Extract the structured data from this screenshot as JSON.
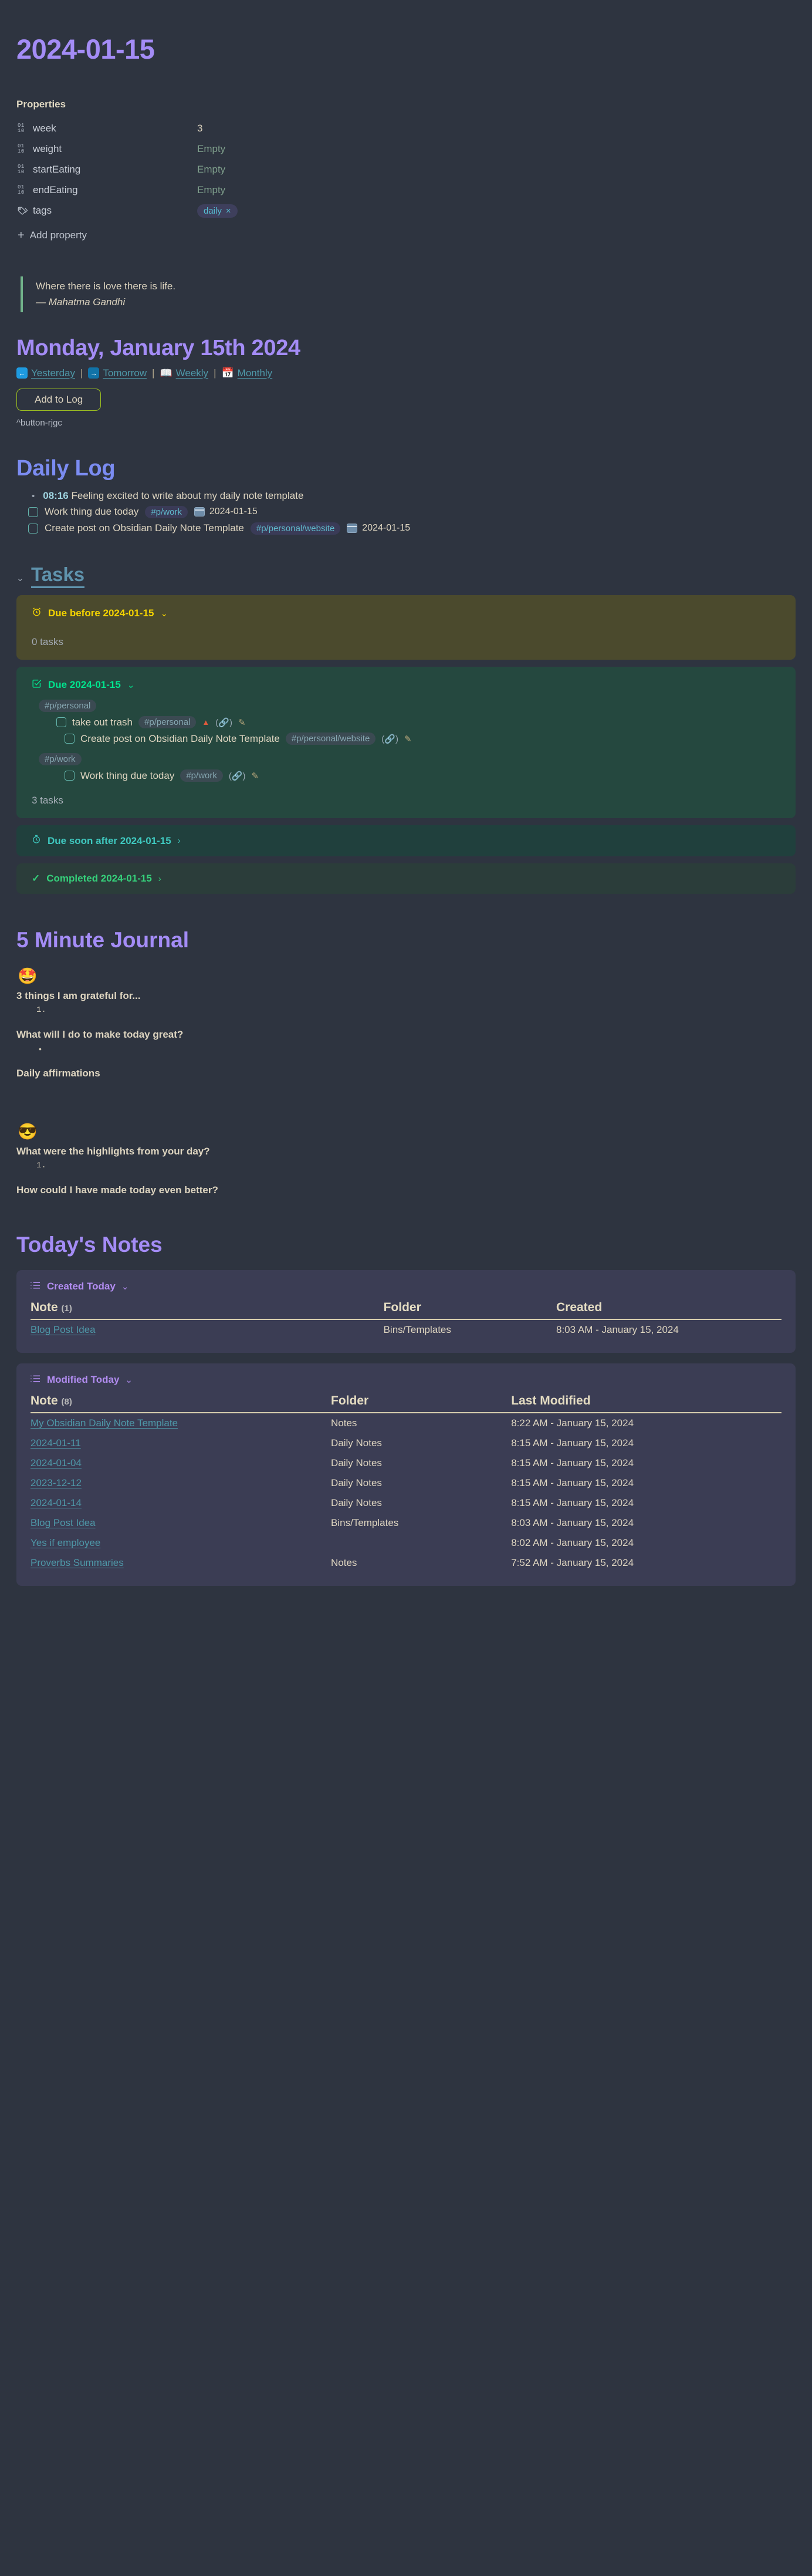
{
  "title": "2024-01-15",
  "properties": {
    "heading": "Properties",
    "rows": [
      {
        "icon": "number-icon",
        "key": "week",
        "value": "3",
        "filled": true
      },
      {
        "icon": "number-icon",
        "key": "weight",
        "value": "Empty",
        "filled": false
      },
      {
        "icon": "number-icon",
        "key": "startEating",
        "value": "Empty",
        "filled": false
      },
      {
        "icon": "number-icon",
        "key": "endEating",
        "value": "Empty",
        "filled": false
      }
    ],
    "tags_key": "tags",
    "tag_value": "daily",
    "tag_remove": "×",
    "add_property": "Add property"
  },
  "quote": {
    "text": "Where there is love there is life.",
    "attribution": "— Mahatma Gandhi"
  },
  "date_heading": "Monday, January 15th 2024",
  "nav": {
    "yesterday": "Yesterday",
    "tomorrow": "Tomorrow",
    "weekly": "Weekly",
    "monthly": "Monthly",
    "separator": "|"
  },
  "add_to_log_button": "Add to Log",
  "button_ref": "^button-rjgc",
  "daily_log": {
    "heading": "Daily Log",
    "entry": {
      "time": "08:16",
      "text": "Feeling excited to write about my daily note template"
    },
    "tasks": [
      {
        "text": "Work thing due today",
        "tag": "#p/work",
        "date": "2024-01-15"
      },
      {
        "text": "Create post on Obsidian Daily Note Template",
        "tag": "#p/personal/website",
        "date": "2024-01-15"
      }
    ]
  },
  "tasks": {
    "heading": "Tasks",
    "overdue": {
      "title": "Due before 2024-01-15",
      "count": "0 tasks"
    },
    "due": {
      "title": "Due 2024-01-15",
      "groups": [
        {
          "tag": "#p/personal",
          "items": [
            {
              "text": "take out trash",
              "tag": "#p/personal",
              "priority": true,
              "indent": 0
            },
            {
              "text": "Create post on Obsidian Daily Note Template",
              "tag": "#p/personal/website",
              "priority": false,
              "indent": 1
            }
          ]
        },
        {
          "tag": "#p/work",
          "items": [
            {
              "text": "Work thing due today",
              "tag": "#p/work",
              "priority": false,
              "indent": 1
            }
          ]
        }
      ],
      "count": "3 tasks"
    },
    "soon": "Due soon after 2024-01-15",
    "completed": "Completed 2024-01-15"
  },
  "journal": {
    "heading": "5 Minute Journal",
    "morning_emoji": "🤩",
    "q1": "3 things I am grateful for...",
    "q1_num": "1.",
    "q2": "What will I do to make today great?",
    "q2_bullet": "•",
    "q3": "Daily affirmations",
    "evening_emoji": "😎",
    "q4": "What were the highlights from your day?",
    "q4_num": "1.",
    "q5": "How could I have made today even better?"
  },
  "notes": {
    "heading": "Today's Notes",
    "created": {
      "title": "Created Today",
      "columns": [
        "Note",
        "Folder",
        "Created"
      ],
      "count": "(1)",
      "rows": [
        {
          "note": "Blog Post Idea",
          "folder": "Bins/Templates",
          "date": "8:03 AM - January 15, 2024"
        }
      ]
    },
    "modified": {
      "title": "Modified Today",
      "columns": [
        "Note",
        "Folder",
        "Last Modified"
      ],
      "count": "(8)",
      "rows": [
        {
          "note": "My Obsidian Daily Note Template",
          "folder": "Notes",
          "date": "8:22 AM - January 15, 2024"
        },
        {
          "note": "2024-01-11",
          "folder": "Daily Notes",
          "date": "8:15 AM - January 15, 2024"
        },
        {
          "note": "2024-01-04",
          "folder": "Daily Notes",
          "date": "8:15 AM - January 15, 2024"
        },
        {
          "note": "2023-12-12",
          "folder": "Daily Notes",
          "date": "8:15 AM - January 15, 2024"
        },
        {
          "note": "2024-01-14",
          "folder": "Daily Notes",
          "date": "8:15 AM - January 15, 2024"
        },
        {
          "note": "Blog Post Idea",
          "folder": "Bins/Templates",
          "date": "8:03 AM - January 15, 2024"
        },
        {
          "note": "Yes if employee",
          "folder": "",
          "date": "8:02 AM - January 15, 2024"
        },
        {
          "note": "Proverbs Summaries",
          "folder": "Notes",
          "date": "7:52 AM - January 15, 2024"
        }
      ]
    }
  },
  "colors": {
    "background": "#2e3440",
    "accent_purple": "#a48cf6",
    "accent_indigo": "#7b8cf2",
    "link_teal": "#4e98a8",
    "cream": "#ded5c0",
    "overdue_yellow": "#f5d400",
    "due_green": "#00e58f"
  }
}
